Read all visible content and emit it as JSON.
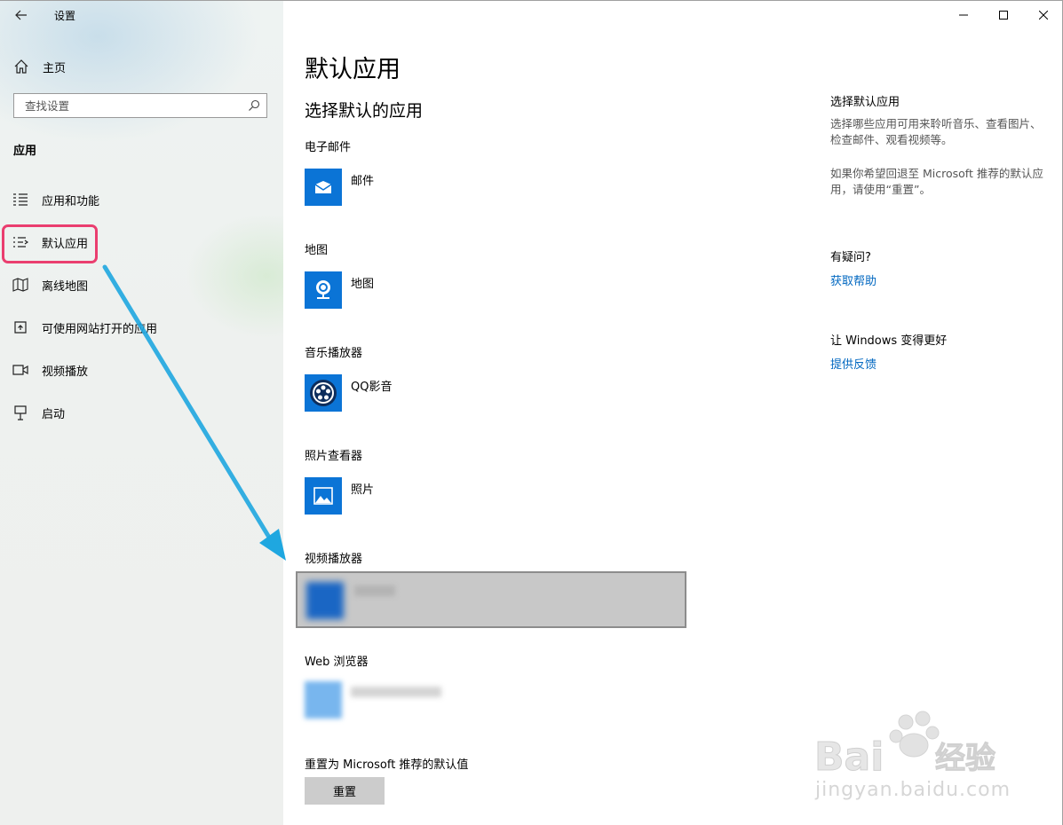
{
  "window": {
    "title": "设置",
    "back_icon": "arrow-left-icon",
    "controls": [
      "minimize-icon",
      "maximize-icon",
      "close-icon"
    ]
  },
  "sidebar": {
    "home_label": "主页",
    "search_placeholder": "查找设置",
    "section_title": "应用",
    "items": [
      {
        "label": "应用和功能",
        "icon": "apps-list-icon"
      },
      {
        "label": "默认应用",
        "icon": "default-apps-icon",
        "highlighted": true
      },
      {
        "label": "离线地图",
        "icon": "offline-map-icon"
      },
      {
        "label": "可使用网站打开的应用",
        "icon": "open-web-icon"
      },
      {
        "label": "视频播放",
        "icon": "video-icon"
      },
      {
        "label": "启动",
        "icon": "startup-icon"
      }
    ],
    "highlight_color": "#ea3e6f",
    "arrow_color": "#1fa7e0"
  },
  "main": {
    "title": "默认应用",
    "subtitle": "选择默认的应用",
    "categories": [
      {
        "label": "电子邮件",
        "app": "邮件",
        "icon": "mail-icon"
      },
      {
        "label": "地图",
        "app": "地图",
        "icon": "map-pin-icon"
      },
      {
        "label": "音乐播放器",
        "app": "QQ影音",
        "icon": "qq-player-icon"
      },
      {
        "label": "照片查看器",
        "app": "照片",
        "icon": "photos-icon"
      },
      {
        "label": "视频播放器",
        "app": "",
        "icon": "blurred-app-icon"
      },
      {
        "label": "Web 浏览器",
        "app": "",
        "icon": "blurred-browser-icon"
      }
    ],
    "reset_label": "重置为 Microsoft 推荐的默认值",
    "reset_button": "重置",
    "tile_color": "#0b74d6"
  },
  "right_panel": {
    "heading1": "选择默认应用",
    "text1": "选择哪些应用可用来聆听音乐、查看图片、检查邮件、观看视频等。",
    "text2": "如果你希望回退至 Microsoft 推荐的默认应用，请使用“重置”。",
    "heading2": "有疑问?",
    "link1": "获取帮助",
    "heading3": "让 Windows 变得更好",
    "link2": "提供反馈",
    "link_color": "#0067c0"
  },
  "watermark": {
    "brand": "Bai经验",
    "url": "jingyan.baidu.com"
  }
}
